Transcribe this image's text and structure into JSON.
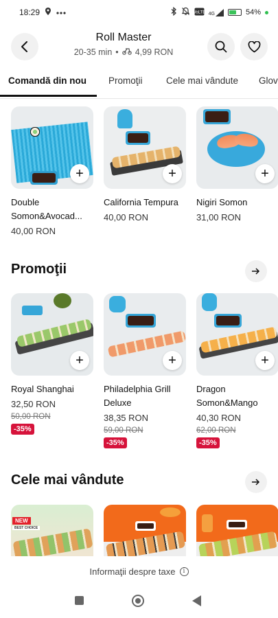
{
  "status_bar": {
    "time": "18:29",
    "left_icons": [
      "location-pin-icon",
      "more-dots-icon"
    ],
    "battery_text": "54%",
    "battery_level": 0.54,
    "network_label": "4G"
  },
  "header": {
    "title": "Roll Master",
    "delivery_time": "20-35 min",
    "separator": "•",
    "delivery_fee": "4,99 RON"
  },
  "tabs": [
    {
      "label": "Comandă din nou",
      "active": true
    },
    {
      "label": "Promoţii",
      "active": false
    },
    {
      "label": "Cele mai vândute",
      "active": false
    },
    {
      "label": "Glov",
      "active": false
    }
  ],
  "reorder": {
    "items": [
      {
        "name": "Double Somon&Avocad...",
        "price": "40,00 RON"
      },
      {
        "name": "California Tempura",
        "price": "40,00 RON"
      },
      {
        "name": "Nigiri Somon",
        "price": "31,00 RON"
      }
    ]
  },
  "promotions": {
    "title": "Promoţii",
    "items": [
      {
        "name": "Royal Shanghai",
        "price": "32,50 RON",
        "old_price": "50,00 RON",
        "discount": "-35%"
      },
      {
        "name": "Philadelphia Grill Deluxe",
        "price": "38,35 RON",
        "old_price": "59,00 RON",
        "discount": "-35%"
      },
      {
        "name": "Dragon Somon&Mango",
        "price": "40,30 RON",
        "old_price": "62,00 RON",
        "discount": "-35%"
      }
    ]
  },
  "bestsellers": {
    "title": "Cele mai vândute",
    "badge_new": "NEW",
    "badge_best": "BEST CHOICE"
  },
  "footer": {
    "tax_info": "Informaţii despre taxe",
    "info_symbol": "i"
  },
  "colors": {
    "accent": "#111111",
    "discount": "#d6133b",
    "mat_blue": "#2aa9d8"
  }
}
